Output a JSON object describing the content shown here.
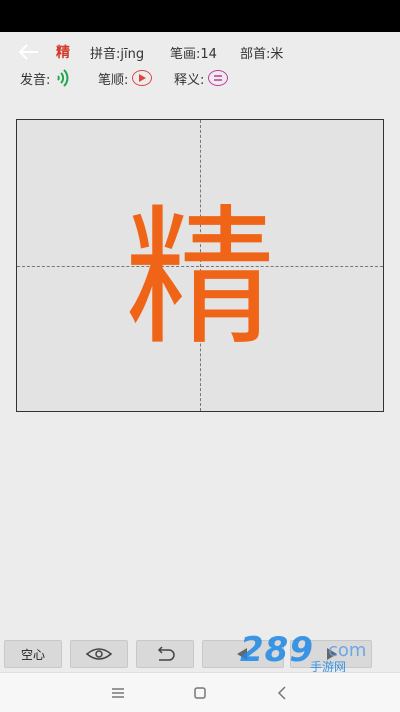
{
  "header": {
    "character": "精",
    "pinyin": "拼音:jīng",
    "strokes": "笔画:14",
    "radical": "部首:米"
  },
  "controls": {
    "pronunciation_label": "发音:",
    "stroke_order_label": "笔顺:",
    "meaning_label": "释义:"
  },
  "canvas": {
    "display_character": "精"
  },
  "toolbar": {
    "hollow_label": "空心"
  },
  "watermark": {
    "number": "289",
    "tail": "com",
    "label": "手游网"
  },
  "colors": {
    "character_red": "#d2392a",
    "stroke_orange": "#f06418",
    "sound_green": "#1fa84a",
    "accent_purple": "#c0399c"
  }
}
